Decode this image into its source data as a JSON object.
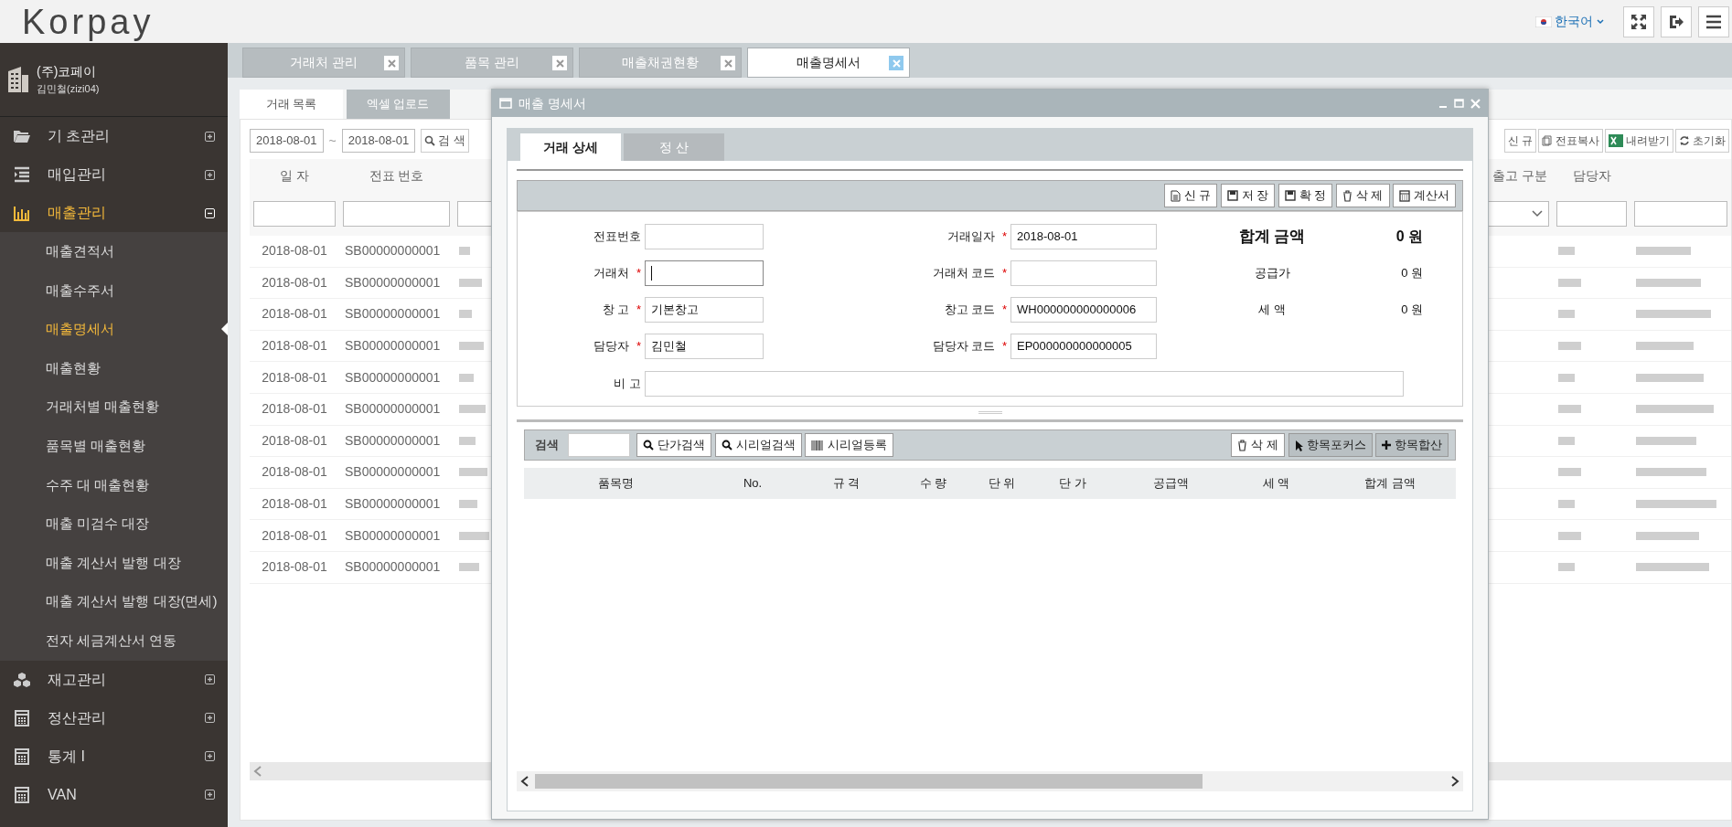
{
  "header": {
    "logo": "Korpay",
    "language": "한국어"
  },
  "sidebar": {
    "company": "(주)코페이",
    "user": "김민철(zizi04)",
    "menu": [
      {
        "label": "기 초관리",
        "expanded": false
      },
      {
        "label": "매입관리",
        "expanded": false
      },
      {
        "label": "매출관리",
        "expanded": true,
        "children": [
          {
            "label": "매출견적서",
            "selected": false
          },
          {
            "label": "매출수주서",
            "selected": false
          },
          {
            "label": "매출명세서",
            "selected": true
          },
          {
            "label": "매출현황",
            "selected": false
          },
          {
            "label": "거래처별 매출현황",
            "selected": false
          },
          {
            "label": "품목별 매출현황",
            "selected": false
          },
          {
            "label": "수주 대 매출현황",
            "selected": false
          },
          {
            "label": "매출 미검수 대장",
            "selected": false
          },
          {
            "label": "매출 계산서 발행 대장",
            "selected": false
          },
          {
            "label": "매출 계산서 발행 대장(면세)",
            "selected": false
          },
          {
            "label": "전자 세금계산서 연동",
            "selected": false
          }
        ]
      },
      {
        "label": "재고관리",
        "expanded": false
      },
      {
        "label": "정산관리",
        "expanded": false
      },
      {
        "label": "통계 I",
        "expanded": false
      },
      {
        "label": "VAN",
        "expanded": false
      }
    ]
  },
  "tabs": [
    {
      "label": "거래처 관리",
      "selected": false
    },
    {
      "label": "품목 관리",
      "selected": false
    },
    {
      "label": "매출채권현황",
      "selected": false
    },
    {
      "label": "매출명세서",
      "selected": true
    }
  ],
  "page": {
    "subtabs": [
      {
        "label": "거래 목록",
        "selected": true
      },
      {
        "label": "엑셀 업로드",
        "selected": false
      }
    ],
    "date_from": "2018-08-01",
    "date_separator": "~",
    "date_to": "2018-08-01",
    "search_button": "검 색",
    "buttons": [
      "신 규",
      "전표복사",
      "내려받기",
      "초기화"
    ],
    "columns": [
      "일 자",
      "전표 번호",
      "출고 구분",
      "담당자"
    ],
    "rows": [
      {
        "date": "2018-08-01",
        "number": "SB00000000001"
      },
      {
        "date": "2018-08-01",
        "number": "SB00000000001"
      },
      {
        "date": "2018-08-01",
        "number": "SB00000000001"
      },
      {
        "date": "2018-08-01",
        "number": "SB00000000001"
      },
      {
        "date": "2018-08-01",
        "number": "SB00000000001"
      },
      {
        "date": "2018-08-01",
        "number": "SB00000000001"
      },
      {
        "date": "2018-08-01",
        "number": "SB00000000001"
      },
      {
        "date": "2018-08-01",
        "number": "SB00000000001"
      },
      {
        "date": "2018-08-01",
        "number": "SB00000000001"
      },
      {
        "date": "2018-08-01",
        "number": "SB00000000001"
      },
      {
        "date": "2018-08-01",
        "number": "SB00000000001"
      }
    ]
  },
  "dialog": {
    "title": "매출 명세서",
    "tabs": [
      {
        "label": "거래 상세",
        "selected": true
      },
      {
        "label": "정 산",
        "selected": false
      }
    ],
    "toolbar": [
      "신 규",
      "저 장",
      "확 정",
      "삭 제",
      "계산서"
    ],
    "fields_left": [
      {
        "label": "전표번호"
      },
      {
        "label": "거래처",
        "marker": "*",
        "focused": true
      },
      {
        "label": "창 고",
        "marker": "*",
        "value": "기본창고"
      },
      {
        "label": "담당자",
        "marker": "*",
        "value": "김민철"
      }
    ],
    "fields_right": [
      {
        "label": "거래일자",
        "marker": "*",
        "value": "2018-08-01"
      },
      {
        "label": "거래처 코드",
        "marker": "*"
      },
      {
        "label": "창고 코드",
        "marker": "*",
        "value": "WH000000000000006"
      },
      {
        "label": "담당자 코드",
        "marker": "*",
        "value": "EP000000000000005"
      }
    ],
    "totals": [
      {
        "label": "합계 금액",
        "value": "0 원",
        "kind": "grand"
      },
      {
        "label": "공급가",
        "value": "0 원",
        "kind": "line"
      },
      {
        "label": "세 액",
        "value": "0 원",
        "kind": "line"
      }
    ],
    "memo_label": "비 고",
    "search_label": "검색",
    "item_buttons": [
      "단가검색",
      "시리얼검색",
      "시리얼등록"
    ],
    "item_actions": [
      {
        "label": "삭 제",
        "kind": "plain"
      },
      {
        "label": "항목포커스",
        "kind": "toggle"
      },
      {
        "label": "항목합산",
        "kind": "toggle"
      }
    ],
    "columns": [
      "품목명",
      "No.",
      "규 격",
      "수 량",
      "단 위",
      "단 가",
      "공급액",
      "세 액",
      "합계 금액"
    ]
  }
}
